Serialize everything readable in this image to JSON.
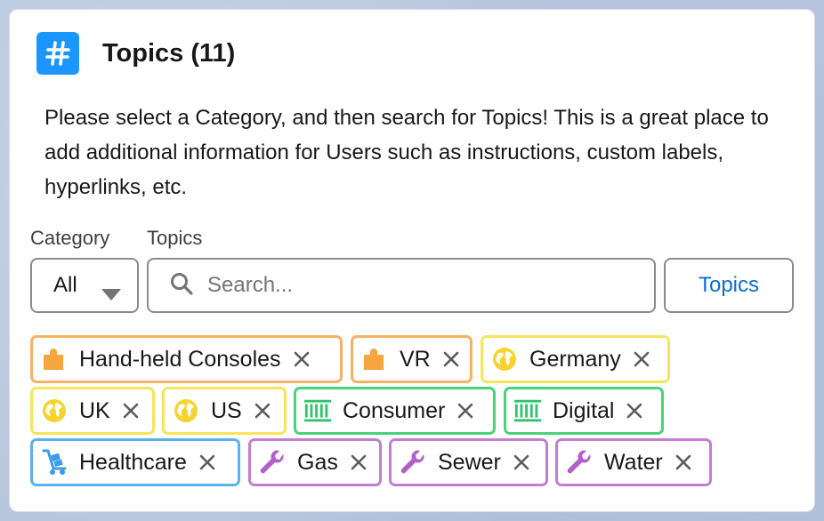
{
  "header": {
    "title": "Topics (11)"
  },
  "description": "Please select a Category, and then search for Topics! This is a great place to add additional information for Users such as instructions, custom labels, hyperlinks, etc.",
  "category": {
    "label": "Category",
    "value": "All"
  },
  "topics": {
    "label": "Topics",
    "placeholder": "Search...",
    "button_label": "Topics"
  },
  "pills": [
    {
      "label": "Hand-held Consoles",
      "icon": "puzzle-icon",
      "color": "#f7b165"
    },
    {
      "label": "VR",
      "icon": "puzzle-icon",
      "color": "#f7b165"
    },
    {
      "label": "Germany",
      "icon": "globe-icon",
      "color": "#f8e45c"
    },
    {
      "label": "UK",
      "icon": "globe-icon",
      "color": "#f8e45c"
    },
    {
      "label": "US",
      "icon": "globe-icon",
      "color": "#f8e45c"
    },
    {
      "label": "Consumer",
      "icon": "barcode-icon",
      "color": "#48d27a"
    },
    {
      "label": "Digital",
      "icon": "barcode-icon",
      "color": "#48d27a"
    },
    {
      "label": "Healthcare",
      "icon": "hand-truck-icon",
      "color": "#5bb0ef"
    },
    {
      "label": "Gas",
      "icon": "wrench-icon",
      "color": "#c37ed4"
    },
    {
      "label": "Sewer",
      "icon": "wrench-icon",
      "color": "#c37ed4"
    },
    {
      "label": "Water",
      "icon": "wrench-icon",
      "color": "#c37ed4"
    }
  ],
  "colors": {
    "accent": "#1b96ff",
    "link": "#0b6cd0"
  }
}
